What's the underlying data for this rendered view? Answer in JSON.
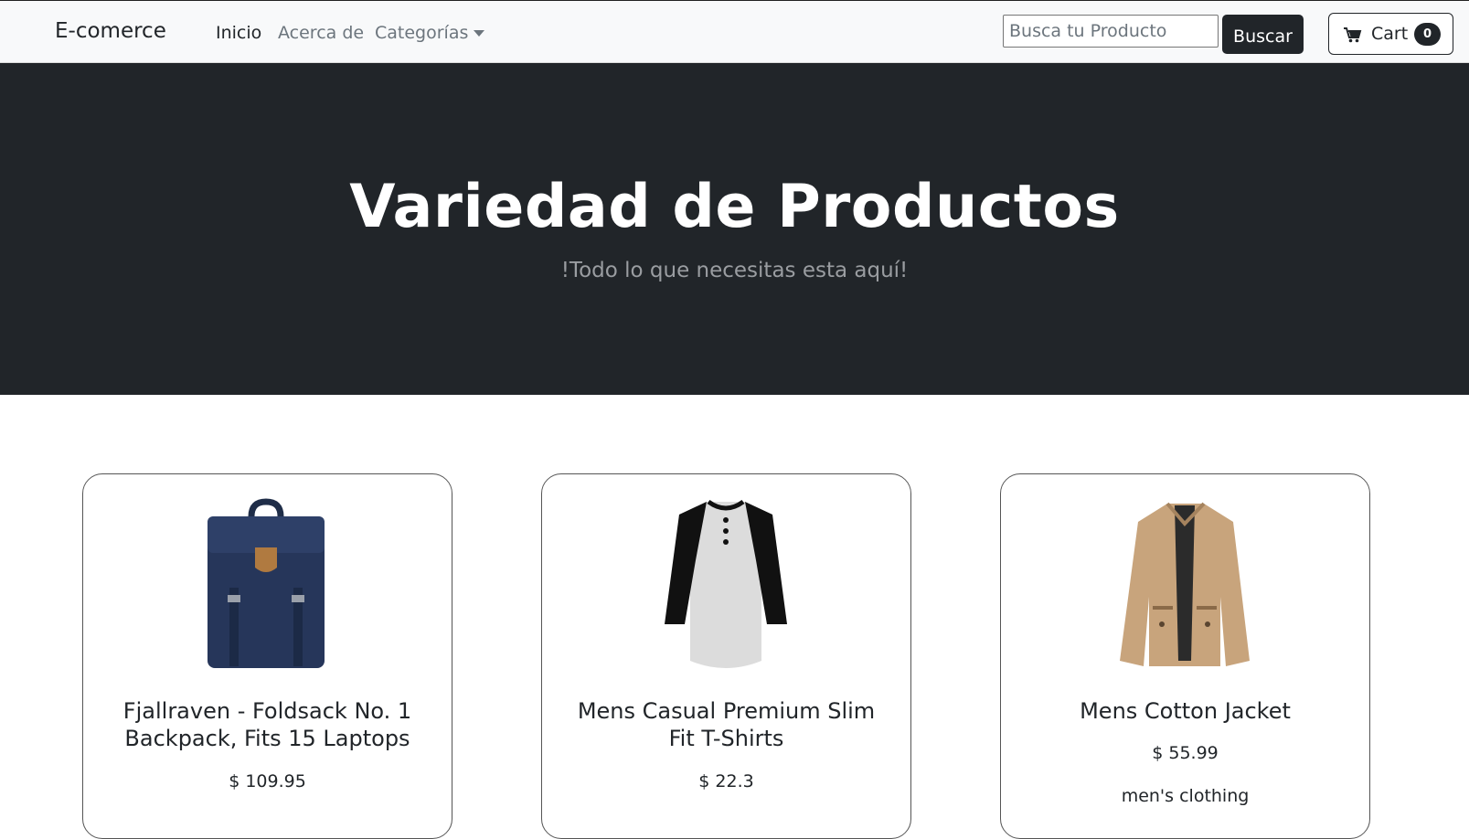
{
  "navbar": {
    "brand": "E-comerce",
    "links": [
      {
        "label": "Inicio"
      },
      {
        "label": "Acerca de"
      },
      {
        "label": "Categorías"
      }
    ],
    "search": {
      "placeholder": "Busca tu Producto",
      "value": "",
      "button_label": "Buscar"
    },
    "cart": {
      "label": "Cart",
      "count": "0",
      "icon": "cart-icon"
    }
  },
  "hero": {
    "title": "Variedad de Productos",
    "subtitle": "!Todo lo que necesitas esta aquí!"
  },
  "products": [
    {
      "title": "Fjallraven - Foldsack No. 1 Backpack, Fits 15 Laptops",
      "price": "$ 109.95",
      "image": "backpack-image"
    },
    {
      "title": "Mens Casual Premium Slim Fit T-Shirts",
      "price": "$ 22.3",
      "image": "tshirt-image"
    },
    {
      "title": "Mens Cotton Jacket",
      "price": "$ 55.99",
      "category": "men's clothing",
      "image": "jacket-image"
    }
  ],
  "colors": {
    "dark": "#212529",
    "navbar_bg": "#f8f9fa",
    "muted": "#6c757d"
  }
}
